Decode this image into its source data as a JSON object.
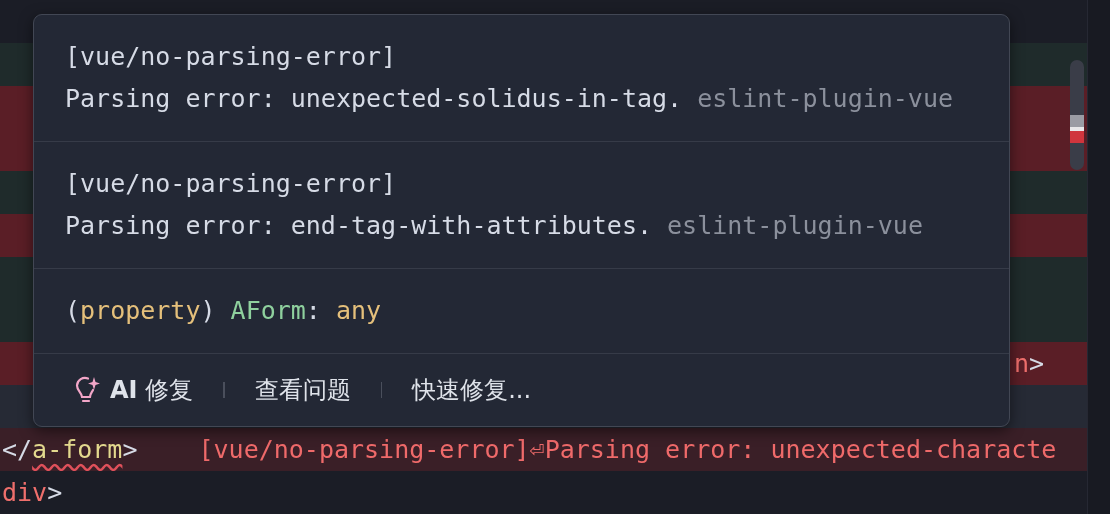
{
  "editor": {
    "lines": [
      {
        "color": "#1f2b2b",
        "kind": "plain"
      },
      {
        "color": "#5a1e26",
        "kind": "plain"
      },
      {
        "color": "#5a1e26",
        "kind": "plain"
      },
      {
        "color": "#1f2b2b",
        "kind": "plain"
      },
      {
        "color": "#5a1e26",
        "kind": "plain"
      },
      {
        "color": "#1f2b2b",
        "kind": "plain"
      },
      {
        "color": "#1f2b2b",
        "kind": "plain"
      },
      {
        "color": "#5a1e26",
        "kind": "tail",
        "tokens": [
          {
            "text": "n",
            "kind": "tag"
          },
          {
            "text": ">",
            "kind": "punct"
          }
        ]
      },
      {
        "color": "#262a35",
        "kind": "plain"
      },
      {
        "color": "#3a1f27",
        "kind": "plain",
        "tokens": [
          {
            "text": "</",
            "kind": "punct"
          },
          {
            "text": "a-form",
            "kind": "component",
            "squiggle": true
          },
          {
            "text": ">",
            "kind": "punct"
          }
        ],
        "inline_diagnostic": "[vue/no-parsing-error]⏎Parsing error: unexpected-characte"
      },
      {
        "color": "#1b1d26",
        "kind": "plain",
        "tokens": [
          {
            "text": "div",
            "kind": "tag"
          },
          {
            "text": ">",
            "kind": "punct"
          }
        ]
      }
    ]
  },
  "hover": {
    "diagnostics": [
      {
        "code": "[vue/no-parsing-error]",
        "message": "Parsing error: unexpected-solidus-in-tag.",
        "source": "eslint-plugin-vue"
      },
      {
        "code": "[vue/no-parsing-error]",
        "message": "Parsing error: end-tag-with-attributes.",
        "source": "eslint-plugin-vue"
      }
    ],
    "signature": [
      {
        "text": "(",
        "kind": "punct"
      },
      {
        "text": "property",
        "kind": "keyword"
      },
      {
        "text": ") ",
        "kind": "punct"
      },
      {
        "text": "AForm",
        "kind": "name"
      },
      {
        "text": ": ",
        "kind": "punct"
      },
      {
        "text": "any",
        "kind": "keyword"
      }
    ],
    "actions": [
      {
        "label": "**AI** 修复",
        "kind": "ai"
      },
      {
        "label": "查看问题",
        "kind": "plain"
      },
      {
        "label": "快速修复...",
        "kind": "plain"
      }
    ]
  }
}
